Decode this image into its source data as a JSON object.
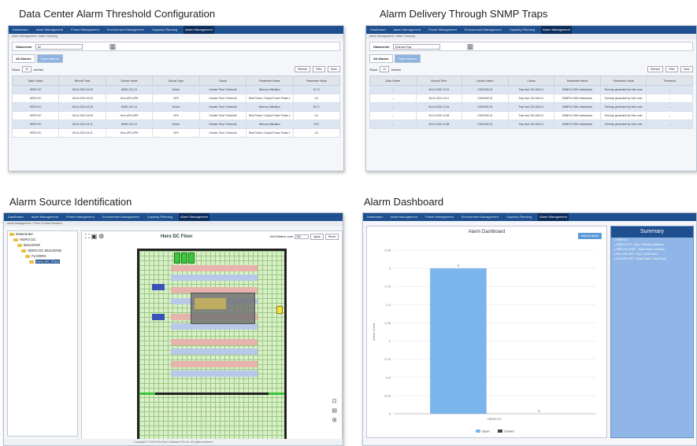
{
  "captions": {
    "threshold": "Data Center Alarm  Threshold Configuration",
    "snmp": "Alarm Delivery Through SNMP Traps",
    "source": "Alarm Source Identification",
    "dashboard": "Alarm Dashboard"
  },
  "nav": {
    "items": [
      "Dashboard",
      "Asset Management",
      "Power Management",
      "Environment Management",
      "Capacity Planning",
      "Alarm Management"
    ],
    "active_index": 5
  },
  "threshold_panel": {
    "breadcrumb": "Alarm Management  >  Alarm Tracking",
    "filter_label": "Datacenter",
    "filter_value": "All",
    "tabs": [
      "All Alarms",
      "Open Alarms"
    ],
    "show_label": "Show",
    "show_value": "10",
    "entries_label": "entries",
    "buttons": [
      "Refresh",
      "Filter",
      "Save"
    ],
    "columns": [
      "Data Center",
      "Record Time",
      "Device Name",
      "Device Type",
      "Cause",
      "Parameter Name",
      "Parameter Value"
    ],
    "rows": [
      [
        "HERO DC",
        "06-04-2015 15:18",
        "HMDC-DC-01",
        "Server",
        "Greater Than Threshold",
        "Memory Utilization",
        "91.74"
      ],
      [
        "HERO DC",
        "06-04-2015 15:18",
        "Hero-UPS-APR",
        "UPS",
        "Greater Than Threshold",
        "Real Power / Output Power Phase 1",
        "0.6"
      ],
      [
        "HERO DC",
        "06-04-2015 15:18",
        "HMDC-DC-01",
        "Server",
        "Greater Than Threshold",
        "Memory Utilization",
        "94.71"
      ],
      [
        "HERO DC",
        "06-04-2015 15:18",
        "Hero-UPS-APR",
        "UPS",
        "Greater Than Threshold",
        "Real Power / Output Power Phase 1",
        "0.6"
      ],
      [
        "HERO DC",
        "06-04-2015 15:11",
        "HMDC-DC-01",
        "Server",
        "Greater Than Threshold",
        "Memory Utilization",
        "93.9"
      ],
      [
        "HERO DC",
        "06-04-2015 15:11",
        "Hero-UPS-APR",
        "UPS",
        "Greater Than Threshold",
        "Real Power / Output Power Phase 1",
        "0.6"
      ]
    ]
  },
  "snmp_panel": {
    "breadcrumb": "Alarm Management  >  Alarm Tracking",
    "filter_label": "Datacenter",
    "filter_value": "External Trap",
    "tabs": [
      "All Alarms",
      "Open Alarms"
    ],
    "show_label": "Show",
    "show_value": "10",
    "entries_label": "entries",
    "buttons": [
      "Refresh",
      "Filter",
      "Save"
    ],
    "columns": [
      "Data Center",
      "Record Time",
      "Device Name",
      "Cause",
      "Parameter Name",
      "Parameter Value",
      "Threshold"
    ],
    "rows": [
      [
        "--",
        "06-04-2015 12:01",
        "CHASSIS-01",
        "Trap from 192.168.0.1",
        "SNMPv2-SMI::enterprises",
        "Test trap generated by Hero user",
        "--"
      ],
      [
        "--",
        "06-04-2015 12:11",
        "CHASSIS-01",
        "Trap from 192.168.0.1",
        "SNMPv2-SMI::enterprises",
        "Test trap generated by Hero user",
        "--"
      ],
      [
        "--",
        "06-04-2015 12:04",
        "CHASSIS-01",
        "Trap from 192.168.0.1",
        "SNMPv2-SMI::enterprises",
        "Test trap generated by Hero user",
        "--"
      ],
      [
        "--",
        "06-04-2015 12:08",
        "CHASSIS-01",
        "Trap from 192.168.0.1",
        "SNMPv2-SMI::enterprises",
        "Test trap generated by Hero user",
        "--"
      ],
      [
        "--",
        "06-04-2015 12:08",
        "CHASSIS-01",
        "Trap from 192.168.0.1",
        "SNMPv2-SMI::enterprises",
        "Test trap generated by Hero user",
        "--"
      ]
    ]
  },
  "source_panel": {
    "breadcrumb": "Asset Management  >  Floor & Rack Elevation",
    "tree": [
      {
        "label": "Datacenter",
        "indent": 0
      },
      {
        "label": "HERO DC",
        "indent": 1
      },
      {
        "label": "BUILDING",
        "indent": 2
      },
      {
        "label": "HERO DC BUILDING",
        "indent": 3
      },
      {
        "label": "FLOORS",
        "indent": 4
      },
      {
        "label": "Hero DC Floor",
        "indent": 5,
        "selected": true
      }
    ],
    "floor_title": "Hero DC Floor",
    "zoom_label": "Grid Relative Level",
    "zoom_value": "100",
    "zoom_buttons": [
      "Apply",
      "Reset"
    ],
    "footer": "Copyright © 2015 HeroTech Software Pvt Ltd. All rights reserved"
  },
  "dashboard_panel": {
    "title": "Alarm Dashboard",
    "button": "Refresh Alarm",
    "summary_title": "Summary",
    "summary_items": [
      "▸ HERO DC",
      "▸ HMDC-DC-01 : Open 1 Memory Utilization",
      "▸ HERO DC SNMP : Closed Alarm 1 Memory",
      "▸ Hero-UPS-APR : Open 1 Real Power",
      "▸ Hero-UPS-APR : Closed Alarm 1 Real Power"
    ]
  },
  "chart_data": {
    "type": "bar",
    "title": "Alarm Dashboard",
    "categories": [
      "HERO DC"
    ],
    "series": [
      {
        "name": "Open",
        "values": [
          2
        ],
        "color": "#7cb4ec"
      },
      {
        "name": "Closed",
        "values": [
          0
        ],
        "color": "#434348"
      }
    ],
    "ylabel": "Alarm Count",
    "ylim": [
      0,
      2.25
    ],
    "yticks": [
      "0",
      "0.25",
      "0.5",
      "0.75",
      "1",
      "1.25",
      "1.5",
      "1.75",
      "2",
      "2.25"
    ],
    "grid": true,
    "legend": "bottom"
  }
}
